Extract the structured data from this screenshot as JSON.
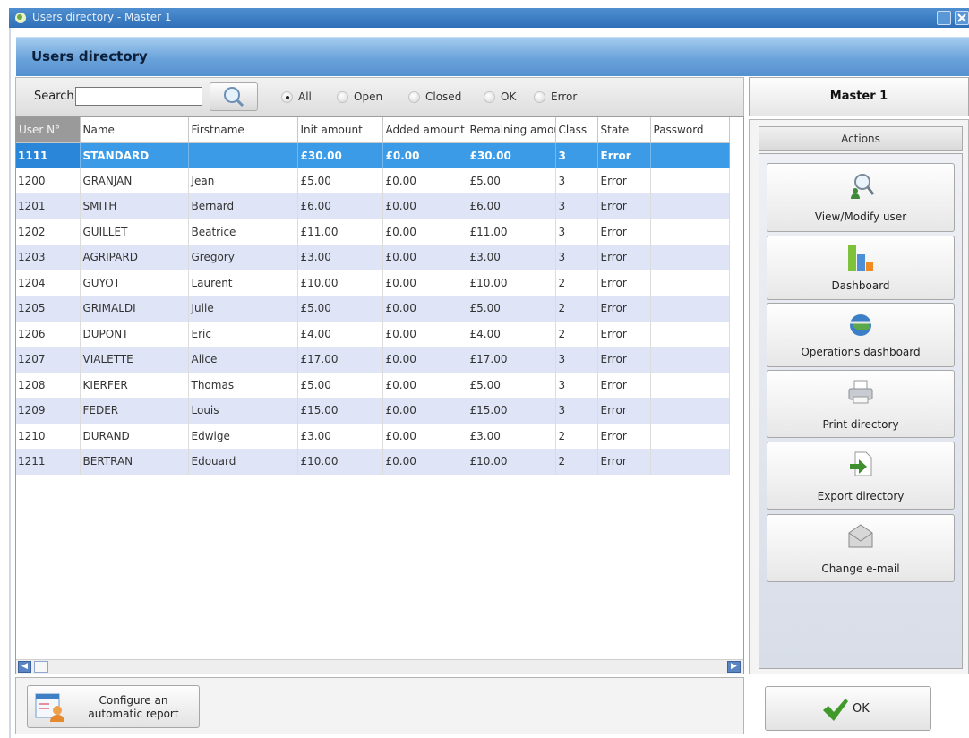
{
  "window": {
    "title": "Users directory - Master 1"
  },
  "header": {
    "title": "Users directory"
  },
  "search": {
    "label": "Search:",
    "value": "",
    "filters": [
      {
        "label": "All",
        "selected": true
      },
      {
        "label": "Open",
        "selected": false
      },
      {
        "label": "Closed",
        "selected": false
      },
      {
        "label": "OK",
        "selected": false
      },
      {
        "label": "Error",
        "selected": false
      }
    ]
  },
  "table": {
    "columns": [
      "User N°",
      "Name",
      "Firstname",
      "Init amount",
      "Added amount",
      "Remaining amou",
      "Class",
      "State",
      "Password"
    ],
    "rows": [
      [
        "1111",
        "STANDARD",
        "",
        "£30.00",
        "£0.00",
        "£30.00",
        "3",
        "Error",
        ""
      ],
      [
        "1200",
        "GRANJAN",
        "Jean",
        "£5.00",
        "£0.00",
        "£5.00",
        "3",
        "Error",
        ""
      ],
      [
        "1201",
        "SMITH",
        "Bernard",
        "£6.00",
        "£0.00",
        "£6.00",
        "3",
        "Error",
        ""
      ],
      [
        "1202",
        "GUILLET",
        "Beatrice",
        "£11.00",
        "£0.00",
        "£11.00",
        "3",
        "Error",
        ""
      ],
      [
        "1203",
        "AGRIPARD",
        "Gregory",
        "£3.00",
        "£0.00",
        "£3.00",
        "3",
        "Error",
        ""
      ],
      [
        "1204",
        "GUYOT",
        "Laurent",
        "£10.00",
        "£0.00",
        "£10.00",
        "2",
        "Error",
        ""
      ],
      [
        "1205",
        "GRIMALDI",
        "Julie",
        "£5.00",
        "£0.00",
        "£5.00",
        "2",
        "Error",
        ""
      ],
      [
        "1206",
        "DUPONT",
        "Eric",
        "£4.00",
        "£0.00",
        "£4.00",
        "2",
        "Error",
        ""
      ],
      [
        "1207",
        "VIALETTE",
        "Alice",
        "£17.00",
        "£0.00",
        "£17.00",
        "3",
        "Error",
        ""
      ],
      [
        "1208",
        "KIERFER",
        "Thomas",
        "£5.00",
        "£0.00",
        "£5.00",
        "3",
        "Error",
        ""
      ],
      [
        "1209",
        "FEDER",
        "Louis",
        "£15.00",
        "£0.00",
        "£15.00",
        "3",
        "Error",
        ""
      ],
      [
        "1210",
        "DURAND",
        "Edwige",
        "£3.00",
        "£0.00",
        "£3.00",
        "2",
        "Error",
        ""
      ],
      [
        "1211",
        "BERTRAN",
        "Edouard",
        "£10.00",
        "£0.00",
        "£10.00",
        "2",
        "Error",
        ""
      ]
    ],
    "selected_row": 0
  },
  "panel": {
    "master": "Master 1",
    "actions_label": "Actions",
    "actions": [
      {
        "label": "View/Modify user",
        "icon": "magnifier-user-icon"
      },
      {
        "label": "Dashboard",
        "icon": "bar-chart-icon"
      },
      {
        "label": "Operations dashboard",
        "icon": "globe-dashboard-icon"
      },
      {
        "label": "Print directory",
        "icon": "printer-icon"
      },
      {
        "label": "Export directory",
        "icon": "export-arrow-icon"
      },
      {
        "label": "Change e-mail",
        "icon": "envelope-icon"
      }
    ]
  },
  "footer": {
    "configure_label": "Configure an automatic report",
    "ok_label": "OK"
  },
  "colors": {
    "accent": "#3b9be6",
    "header": "#6aa3da",
    "alt_row": "#dfe5f7"
  }
}
